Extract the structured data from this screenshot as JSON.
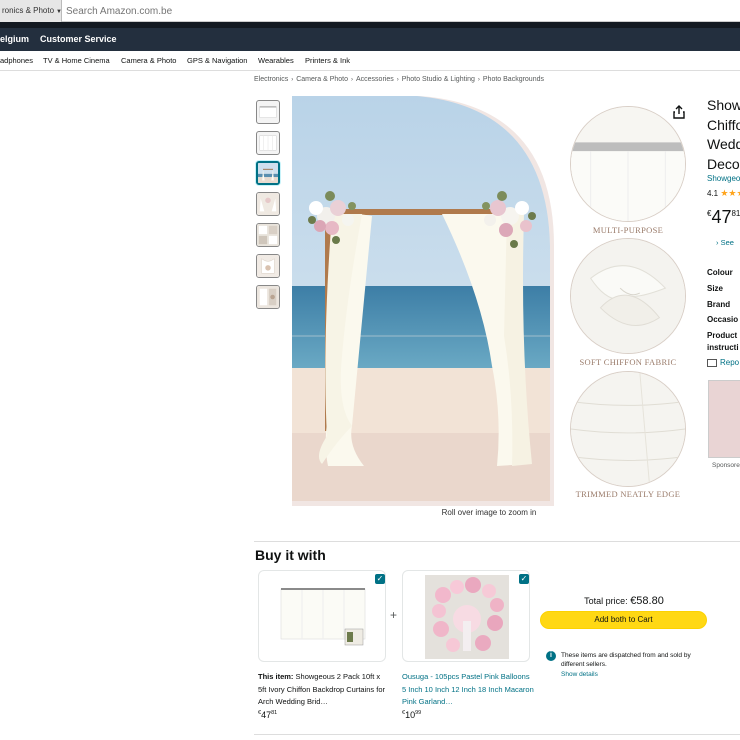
{
  "search": {
    "category": "ronics & Photo",
    "placeholder": "Search Amazon.com.be"
  },
  "nav": {
    "location_partial": "elgium",
    "customer_service": "Customer Service"
  },
  "subnav": [
    "adphones",
    "TV & Home Cinema",
    "Camera & Photo",
    "GPS & Navigation",
    "Wearables",
    "Printers & Ink"
  ],
  "breadcrumb": [
    "Electronics",
    "Camera & Photo",
    "Accessories",
    "Photo Studio & Lighting",
    "Photo Backgrounds"
  ],
  "breadcrumb_sep": "›",
  "gallery": {
    "zoom_hint": "Roll over image to zoom in",
    "active_thumb": 3,
    "features": [
      "MULTI-PURPOSE",
      "SOFT CHIFFON FABRIC",
      "TRIMMED NEATLY EDGE"
    ]
  },
  "product": {
    "title_lines": [
      "Show",
      "Chiffo",
      "Wedd",
      "Deco"
    ],
    "brand_partial": "Showgeo",
    "rating": "4.1",
    "rating_stars": "★★★",
    "price_currency": "€",
    "price_whole": "47",
    "price_fraction": "81",
    "see_partial": "› See",
    "specs": [
      "Colour",
      "Size",
      "Brand",
      "Occasio",
      "Product",
      "instructi"
    ],
    "report_partial": "Repo",
    "sponsored": "Sponsore"
  },
  "buy_it_with": {
    "title": "Buy it with",
    "total_label": "Total price:",
    "total_value": "€58.80",
    "add_both": "Add both to Cart",
    "dispatch_note": "These items are dispatched from and sold by different sellers.",
    "show_details": "Show details",
    "info_glyph": "i",
    "plus": "+",
    "check_glyph": "✓",
    "item1": {
      "lead": "This item:",
      "name": "Showgeous 2 Pack 10ft x 5ft Ivory Chiffon Backdrop Curtains for Arch Wedding Brid…",
      "currency": "€",
      "whole": "47",
      "fraction": "81"
    },
    "item2": {
      "name": "Ousuga - 105pcs Pastel Pink Balloons 5 Inch 10 Inch 12 Inch 18 Inch Macaron Pink Garland…",
      "currency": "€",
      "whole": "10",
      "fraction": "99"
    }
  },
  "colors": {
    "nav_bg": "#232f3e",
    "link": "#007185",
    "button": "#ffd814",
    "feature_text": "#9a7b6a"
  }
}
